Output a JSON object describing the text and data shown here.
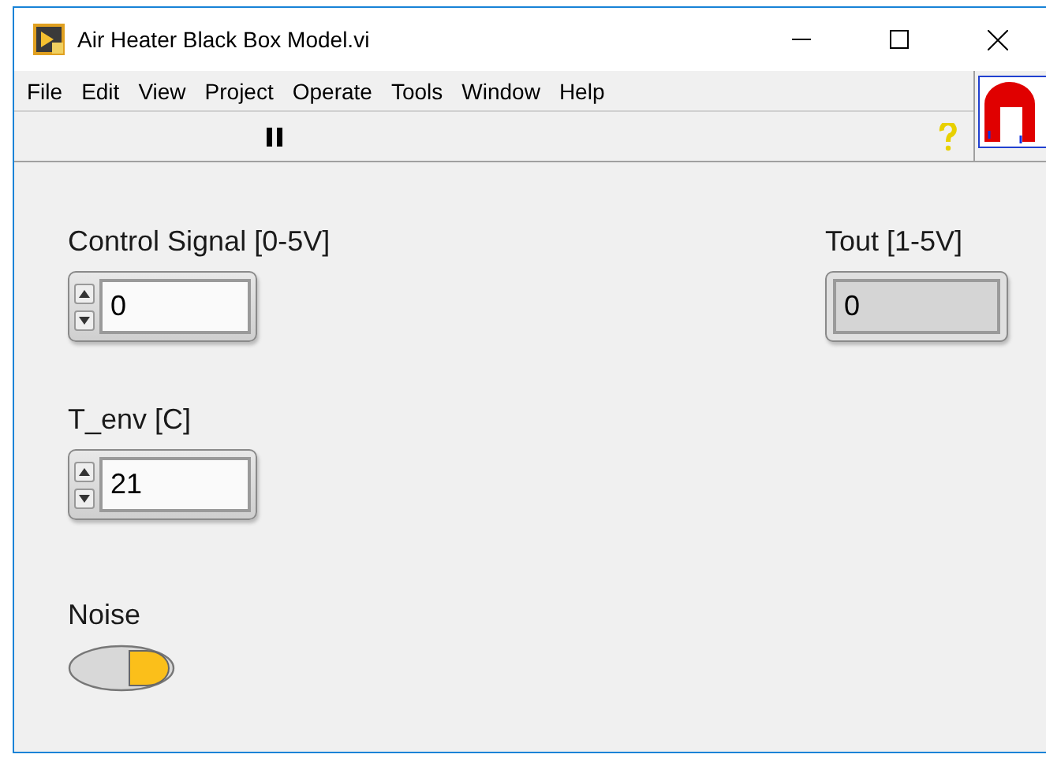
{
  "window": {
    "title": "Air Heater Black Box Model.vi"
  },
  "menu": [
    "File",
    "Edit",
    "View",
    "Project",
    "Operate",
    "Tools",
    "Window",
    "Help"
  ],
  "toolbar": {
    "paused": true
  },
  "panel": {
    "controls": [
      {
        "kind": "numeric",
        "label": "Control Signal [0-5V]",
        "value": "0"
      },
      {
        "kind": "numeric",
        "label": "T_env [C]",
        "value": "21"
      },
      {
        "kind": "switch",
        "label": "Noise",
        "on": true
      },
      {
        "kind": "indicator",
        "label": "Tout [1-5V]",
        "value": "0"
      }
    ]
  }
}
